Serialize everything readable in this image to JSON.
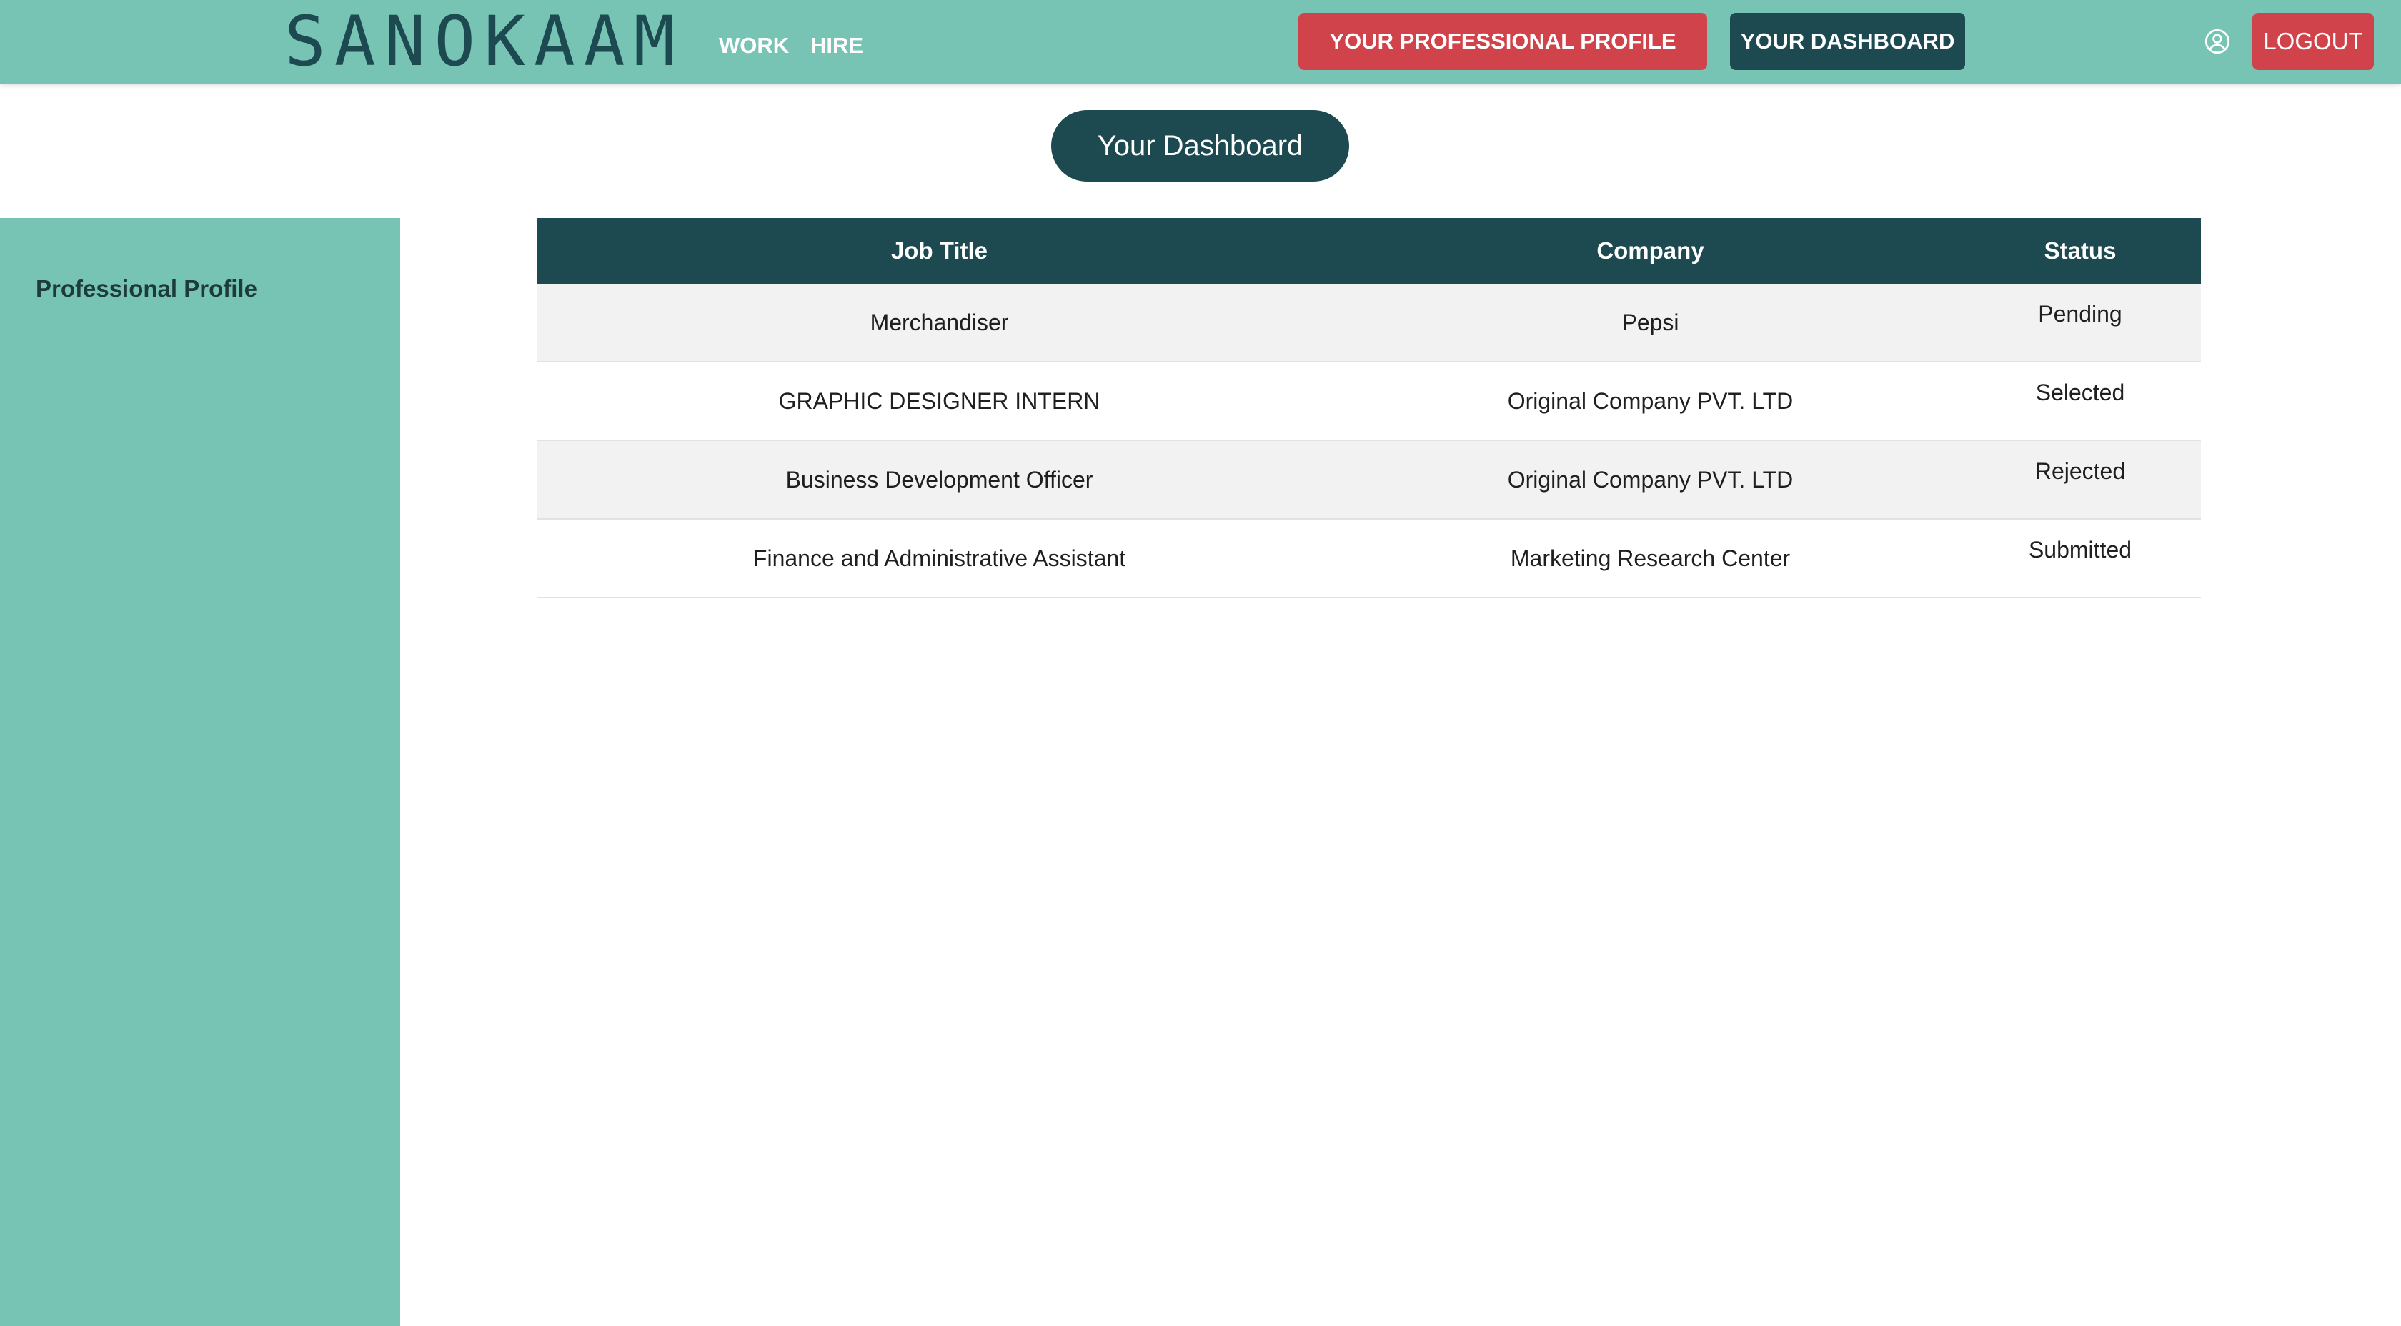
{
  "navbar": {
    "logo": "SANOKAAM",
    "links": {
      "work": "WORK",
      "hire": "HIRE"
    },
    "buttons": {
      "profile": "YOUR PROFESSIONAL PROFILE",
      "dashboard": "YOUR DASHBOARD",
      "logout": "LOGOUT"
    },
    "icons": {
      "user": "user-circle-icon"
    }
  },
  "main": {
    "title": "Your Dashboard"
  },
  "sidebar": {
    "items": [
      {
        "label": "Professional Profile"
      }
    ]
  },
  "table": {
    "headers": [
      "Job Title",
      "Company",
      "Status"
    ],
    "rows": [
      {
        "title": "Merchandiser",
        "company": "Pepsi",
        "status": "Pending"
      },
      {
        "title": "GRAPHIC DESIGNER INTERN",
        "company": "Original Company PVT. LTD",
        "status": "Selected"
      },
      {
        "title": "Business Development Officer",
        "company": "Original Company PVT. LTD",
        "status": "Rejected"
      },
      {
        "title": "Finance and Administrative Assistant",
        "company": "Marketing Research Center",
        "status": "Submitted"
      }
    ]
  },
  "colors": {
    "teal": "#77c4b5",
    "dark_teal": "#1c4a50",
    "red": "#d0434b",
    "row_alt": "#f2f2f2"
  }
}
